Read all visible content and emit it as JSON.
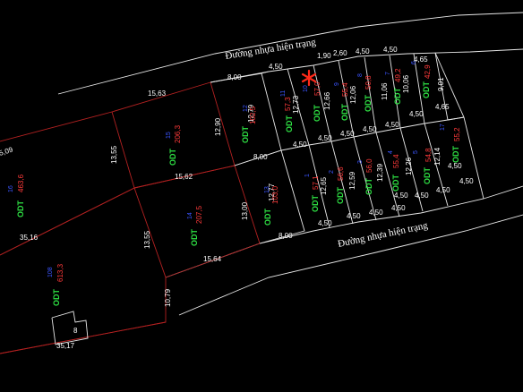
{
  "roads": {
    "top": "Đường nhựa hiện trạng",
    "bottom": "Đường nhựa hiện trạng"
  },
  "dimensions": {
    "d_1563": "15,63",
    "d_1355a": "13,55",
    "d_1355b": "13,55",
    "d_1562": "15,62",
    "d_1564": "15,64",
    "d_3516": "35,16",
    "d_3517": "35,17",
    "d_509": "5,09",
    "d_1079": "10,79",
    "d_800a": "8,00",
    "d_800b": "8,00",
    "d_800c": "8,00",
    "d_1290": "12,90",
    "d_1300": "13,00",
    "d_1279": "12,79",
    "d_1277": "12,77",
    "d_450_top1": "4,50",
    "d_190": "1,90",
    "d_260": "2,60",
    "d_450_top2": "4,50",
    "d_450_top3": "4,50",
    "d_465a": "4,65",
    "d_465b": "4,65",
    "d_1273": "12,73",
    "d_1266": "12,66",
    "d_1206": "12,06",
    "d_1106": "11,06",
    "d_1006": "10,06",
    "d_901": "9,01",
    "d_450_r1a": "4,50",
    "d_450_r1b": "4,50",
    "d_450_r1c": "4,50",
    "d_450_r1d": "4,50",
    "d_450_r1e": "4,50",
    "d_450_r2a": "4,50",
    "d_450_r2b": "4,50",
    "d_450_r2c": "4,50",
    "d_450_r2d": "4,50",
    "d_450_r2e": "4,50",
    "d_450_r3a": "4,50",
    "d_450_r3b": "4,50",
    "d_450_r3c": "4,50",
    "d_450_r3d": "4,50",
    "d_450_r3e": "4,50",
    "d_1265": "12,65",
    "d_1259": "12,59",
    "d_1239": "12,39",
    "d_1226": "12,26",
    "d_1214": "12,14"
  },
  "parcels": [
    {
      "label": "ODT",
      "num": "16",
      "area": "463,6"
    },
    {
      "label": "ODT",
      "num": "15",
      "area": "206,3"
    },
    {
      "label": "ODT",
      "num": "14",
      "area": "207,5"
    },
    {
      "label": "ODT",
      "num": "108",
      "area": "613,3"
    },
    {
      "label": "ODT",
      "num": "12",
      "area": "102,5"
    },
    {
      "label": "ODT",
      "num": "13",
      "area": "103,0"
    },
    {
      "label": "ODT",
      "num": "11",
      "area": "57,3"
    },
    {
      "label": "ODT",
      "num": "10",
      "area": "57,0"
    },
    {
      "label": "ODT",
      "num": "9",
      "area": "55,4"
    },
    {
      "label": "ODT",
      "num": "8",
      "area": "50,8"
    },
    {
      "label": "ODT",
      "num": "7",
      "area": "49,2"
    },
    {
      "label": "ODT",
      "num": "6",
      "area": "42,9"
    },
    {
      "label": "ODT",
      "num": "1",
      "area": "57,1"
    },
    {
      "label": "ODT",
      "num": "2",
      "area": "56,6"
    },
    {
      "label": "ODT",
      "num": "3",
      "area": "56,0"
    },
    {
      "label": "ODT",
      "num": "4",
      "area": "55,4"
    },
    {
      "label": "ODT",
      "num": "5",
      "area": "54,8"
    },
    {
      "label": "ODT",
      "num": "17",
      "area": "55,2"
    }
  ],
  "house_label": "8",
  "colors": {
    "background": "#000000",
    "boundary": "#e8e8e8",
    "red_boundary": "#b32121",
    "land_type": "#2ee043",
    "parcel_number": "#3b55ff",
    "area": "#ff3a3a",
    "marker": "#ff2a1a"
  },
  "icons": [
    "asterisk-marker-icon"
  ]
}
